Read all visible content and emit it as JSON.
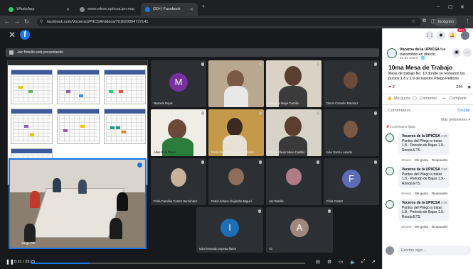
{
  "browser": {
    "tabs": [
      {
        "title": "WhatsApp",
        "active": false
      },
      {
        "title": "www.vdesc.upiicsa.ipn.mx",
        "active": false
      },
      {
        "title": "(20+) Facebook",
        "active": true
      }
    ],
    "new_tab": "+",
    "url": "facebook.com/VocerosUPIICSA/videos/701620004737141",
    "incognito_label": "Incógnito"
  },
  "video": {
    "presenting_text": "Jair Botello está presentando",
    "time_label": "5:21 / 25:25",
    "progress": 0.21,
    "participants": [
      {
        "name": "Marcela Rojas",
        "initial": "M",
        "color": "#7b2fa0"
      },
      {
        "name": "",
        "initial": "",
        "color": ""
      },
      {
        "name": "Eduardo Mejia Castillo",
        "initial": "",
        "color": ""
      },
      {
        "name": "Dinori Cornelio Ramirez",
        "initial": "",
        "color": ""
      },
      {
        "name": "Allan Brito Rojas",
        "initial": "",
        "color": ""
      },
      {
        "name": "Paola Daniel Vázquez Gonzalez",
        "initial": "",
        "color": ""
      },
      {
        "name": "Sergio Alexis Mesa Castillo",
        "initial": "",
        "color": ""
      },
      {
        "name": "Iván García Laredo",
        "initial": "",
        "color": ""
      },
      {
        "name": "Frida Carolina Cortez Hernández",
        "initial": "",
        "color": ""
      },
      {
        "name": "Fadel Adamo Alejandro Miguel",
        "initial": "",
        "color": ""
      },
      {
        "name": "Jair Botello",
        "initial": "",
        "color": ""
      },
      {
        "name": "Frida Cortez",
        "initial": "F",
        "color": "#5b6bb5"
      },
      {
        "name": "Iván fernando zepeda flores",
        "initial": "I",
        "color": "#1c6eb5"
      },
      {
        "name": "Tú",
        "initial": "A",
        "color": "#a1887f"
      }
    ],
    "room_label": "Junga Oth"
  },
  "sidebar": {
    "notif_count": "20+",
    "page_name": "Voceros de la UPIICSA",
    "page_action": "fue transmitido en directo.",
    "post_date": "20 de enero · 🌐",
    "post_title": "10ma Mesa de Trabajo",
    "post_body": "Mesa de trabajo No. 10 donde se revisaron los puntos 1.8 y 1.9 de nuestro Pliego Petitorio",
    "reactions": "2",
    "views": "244",
    "actions": {
      "like": "Me gusta",
      "comment": "Comentar",
      "share": "Compartir"
    },
    "comments_label": "Comentarios",
    "hide_label": "Ocultar",
    "sort_label": "Más pertinentes",
    "pinned_label": "Comentario fijado",
    "comments": [
      {
        "author": "Voceros de la UPIICSA",
        "time": "0:00",
        "text": "Puntos del Pliego a tratar: 1.8.- Periodo de Bajas 1.9.- Ronda ETS",
        "meta": "48 sem",
        "like": "Me gusta",
        "reply": "Responder"
      },
      {
        "author": "Voceros de la UPIICSA",
        "time": "0:00",
        "text": "Puntos del Pliego a tratar: 1.8.- Periodo de Bajas 1.9.- Ronda ETS",
        "meta": "48 sem",
        "like": "Me gusta",
        "reply": "Responder"
      },
      {
        "author": "Voceros de la UPIICSA",
        "time": "0:00",
        "text": "Puntos del Pliego a tratar: 1.8.- Periodo de Bajas 1.9.- Ronda ETS",
        "meta": "48 sem",
        "like": "Me gusta",
        "reply": "Responder"
      }
    ],
    "write_placeholder": "Escribe algo..."
  }
}
